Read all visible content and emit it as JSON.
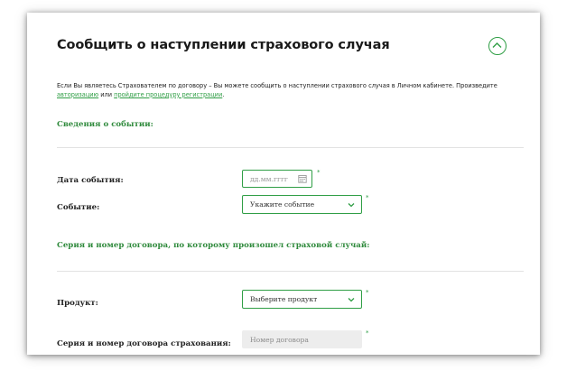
{
  "form": {
    "title": "Сообщить о наступлении страхового случая",
    "intro_text": "Если Вы являетесь Страхователем по договору – Вы можете сообщить о наступлении страхового случая в Личном кабинете. Произведите ",
    "intro_link_auth": "авторизацию",
    "intro_middle": " или ",
    "intro_link_register": "пройдите процедуру регистрации",
    "intro_end": ".",
    "section_event": "Сведения о событии:",
    "event_date_label": "Дата события:",
    "event_date_placeholder": "дд.мм.гггг",
    "event_label": "Событие:",
    "event_select_value": "Укажите событие",
    "section_contract": "Серия и номер договора, по которому произошел страховой случай:",
    "product_label": "Продукт:",
    "product_select_value": "Выберите продукт",
    "contract_label": "Серия и номер договора страхования:",
    "contract_placeholder": "Номер договора",
    "required_mark": "*"
  },
  "colors": {
    "accent": "#2f9e45",
    "section_text": "#2f8a3c",
    "input_disabled_bg": "#ededed"
  },
  "icons": {
    "collapse": "chevron-up-icon",
    "date": "calendar-icon",
    "select": "chevron-down-icon"
  }
}
